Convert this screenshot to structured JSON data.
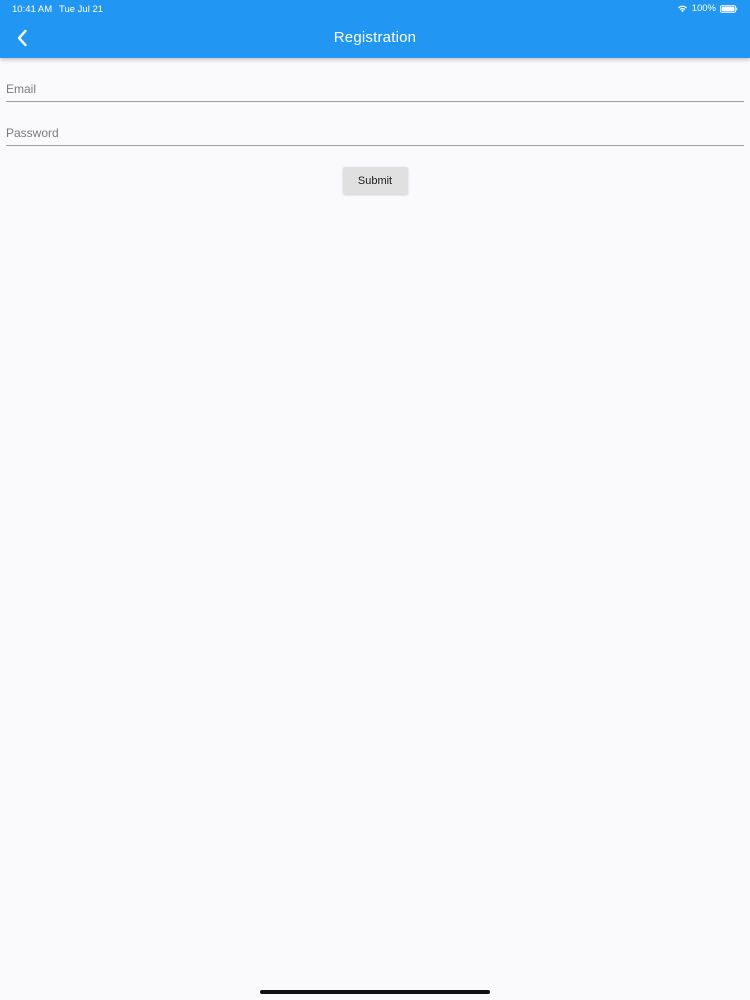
{
  "status_bar": {
    "time": "10:41 AM",
    "date": "Tue Jul 21",
    "battery": "100%",
    "icons": [
      "wifi-icon",
      "battery-icon"
    ]
  },
  "app_bar": {
    "title": "Registration",
    "back_icon": "chevron-left-icon",
    "color": "#2196f3"
  },
  "form": {
    "email": {
      "placeholder": "Email",
      "value": ""
    },
    "password": {
      "placeholder": "Password",
      "value": ""
    },
    "submit_label": "Submit"
  },
  "colors": {
    "background": "#faf9fc",
    "accent": "#2196f3",
    "button": "#e0e0e0"
  }
}
